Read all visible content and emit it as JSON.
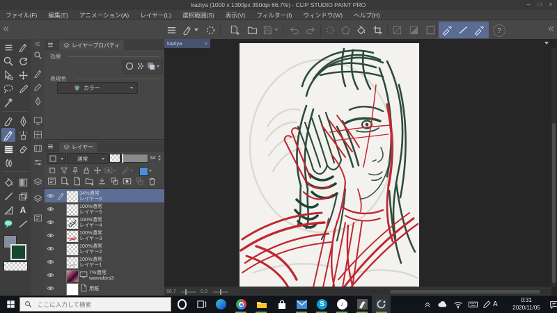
{
  "window": {
    "title": "kaziya (1000 x 1300px 350dpi 66.7%)  - CLIP STUDIO PAINT PRO",
    "minimize": "–",
    "maximize": "□",
    "close": "×"
  },
  "menubar": {
    "items": [
      "ファイル(F)",
      "編集(E)",
      "アニメーション(A)",
      "レイヤー(L)",
      "選択範囲(S)",
      "表示(V)",
      "フィルター(I)",
      "ウィンドウ(W)",
      "ヘルプ(H)"
    ]
  },
  "commandbar": {
    "help": "?"
  },
  "layer_property": {
    "tab": "レイヤープロパティ",
    "effect_label": "効果",
    "expression_label": "表現色",
    "color_value": "カラー"
  },
  "layers_panel": {
    "tab": "レイヤー",
    "blend_mode": "通常",
    "opacity_value": "34",
    "rows": [
      {
        "meta": "34%通常",
        "name": "レイヤー6"
      },
      {
        "meta": "100%通常",
        "name": "レイヤー5"
      },
      {
        "meta": "100%通常",
        "name": "レイヤー4"
      },
      {
        "meta": "100%通常",
        "name": "レイヤー3"
      },
      {
        "meta": "100%通常",
        "name": "レイヤー2"
      },
      {
        "meta": "100%通常",
        "name": "レイヤー1"
      },
      {
        "meta": "7%通常",
        "name": "wanndors3"
      },
      {
        "meta": "",
        "name": "用紙"
      }
    ]
  },
  "canvas": {
    "doc_tab": "kaziya",
    "tab_close": "×",
    "zoom": "66.7",
    "rotation": "0.0"
  },
  "taskbar": {
    "search_placeholder": "ここに入力して検索",
    "ime_mode": "A",
    "time": "0:31",
    "date": "2020/11/05"
  },
  "colors": {
    "accent_selection": "#5b6c92",
    "selected_layer_row": "#5c6e96",
    "doc_tab": "#46536e",
    "sketch_green": "#2d4c3d",
    "sketch_red": "#c02832",
    "paper": "#f4f2ef",
    "taskbar_run_indicator": "#7fa35c",
    "sub_color_swatch": "#17472f",
    "main_color_swatch": "#878da1"
  }
}
